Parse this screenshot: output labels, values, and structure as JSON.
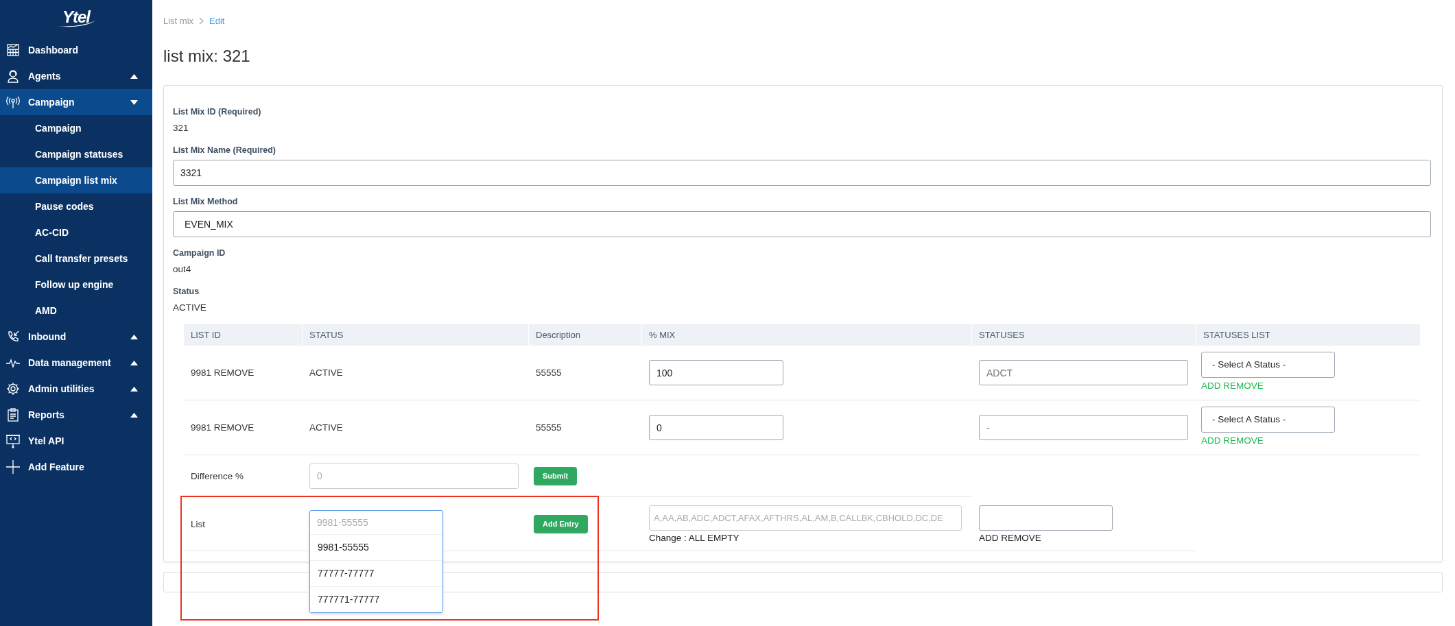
{
  "sidebar": {
    "logo": "Ytel",
    "items": [
      {
        "label": "Dashboard",
        "kind": "link",
        "selected": false
      },
      {
        "label": "Agents",
        "kind": "group",
        "expanded": false,
        "selected": false
      },
      {
        "label": "Campaign",
        "kind": "group",
        "expanded": true,
        "selected": true,
        "children": [
          {
            "label": "Campaign",
            "selected": false
          },
          {
            "label": "Campaign statuses",
            "selected": false
          },
          {
            "label": "Campaign list mix",
            "selected": true
          },
          {
            "label": "Pause codes",
            "selected": false
          },
          {
            "label": "AC-CID",
            "selected": false
          },
          {
            "label": "Call transfer presets",
            "selected": false
          },
          {
            "label": "Follow up engine",
            "selected": false
          },
          {
            "label": "AMD",
            "selected": false
          }
        ]
      },
      {
        "label": "Inbound",
        "kind": "group",
        "expanded": false,
        "selected": false
      },
      {
        "label": "Data management",
        "kind": "group",
        "expanded": false,
        "selected": false
      },
      {
        "label": "Admin utilities",
        "kind": "group",
        "expanded": false,
        "selected": false
      },
      {
        "label": "Reports",
        "kind": "group",
        "expanded": false,
        "selected": false
      },
      {
        "label": "Ytel API",
        "kind": "link",
        "selected": false
      },
      {
        "label": "Add Feature",
        "kind": "link",
        "selected": false
      }
    ]
  },
  "breadcrumb": [
    "List mix",
    "Edit"
  ],
  "title": "list mix: 321",
  "form": {
    "fields": [
      {
        "kind": "static",
        "label": "List Mix ID (Required)",
        "value": "321"
      },
      {
        "kind": "input",
        "label": "List Mix Name (Required)",
        "value": "3321"
      },
      {
        "kind": "select",
        "label": "List Mix Method",
        "value": "EVEN_MIX"
      },
      {
        "kind": "static",
        "label": "Campaign ID",
        "value": "out4"
      },
      {
        "kind": "static",
        "label": "Status",
        "value": "ACTIVE"
      }
    ]
  },
  "table": {
    "columns": [
      "LIST ID",
      "STATUS",
      "Description",
      "% MIX",
      "STATUSES",
      "STATUSES LIST"
    ],
    "rows": [
      {
        "list_id": "9981 REMOVE",
        "status": "ACTIVE",
        "description": "55555",
        "mix": "100",
        "statuses": "ADCT",
        "statuses_list": "- Select A Status -",
        "action": "ADD REMOVE"
      },
      {
        "list_id": "9981 REMOVE",
        "status": "ACTIVE",
        "description": "55555",
        "mix": "0",
        "statuses": "-",
        "statuses_list": "- Select A Status -",
        "action": "ADD REMOVE"
      }
    ]
  },
  "difference": {
    "label": "Difference %",
    "placeholder": "0",
    "button": "Submit"
  },
  "list_entry": {
    "label": "List",
    "dropdown": {
      "placeholder": "9981-55555",
      "expanded": true,
      "options": [
        "9981-55555",
        "77777-77777",
        "777771-77777"
      ]
    },
    "button": "Add Entry",
    "statuses_field": {
      "placeholder": "A,AA,AB,ADC,ADCT,AFAX,AFTHRS,AL,AM,B,CALLBK,CBHOLD,DC,DE"
    },
    "change_note": "Change : ALL EMPTY",
    "action": "ADD REMOVE"
  }
}
